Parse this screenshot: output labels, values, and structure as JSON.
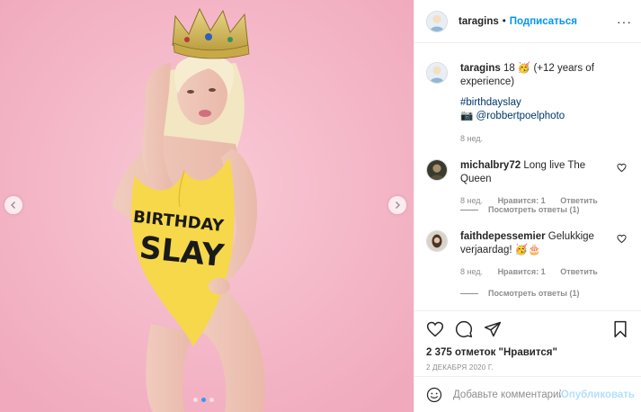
{
  "header": {
    "username": "taragins",
    "separator": "•",
    "follow_label": "Подписаться",
    "more_label": "···"
  },
  "caption": {
    "username": "taragins",
    "text_1": " 18 🥳 (+12 years of experience)",
    "hashtag": "#birthdayslay",
    "camera_emoji": "📷",
    "mention": "@robbertpoelphoto",
    "time": "8 нед."
  },
  "comments": [
    {
      "username": "michalbry72",
      "text": " Long live The Queen",
      "time": "8 нед.",
      "likes": "Нравится: 1",
      "reply_label": "Ответить",
      "view_replies": "Посмотреть ответы (1)"
    },
    {
      "username": "faithdepessemier",
      "text": " Gelukkige verjaardag! 🥳🎂",
      "time": "8 нед.",
      "likes": "Нравится: 1",
      "reply_label": "Ответить",
      "view_replies": "Посмотреть ответы (1)"
    }
  ],
  "actions": {
    "likes": "2 375 отметок \"Нравится\"",
    "date": "2 ДЕКАБРЯ 2020 Г."
  },
  "add_comment": {
    "placeholder": "Добавьте комментарий...",
    "post_label": "Опубликовать"
  },
  "photo": {
    "swimsuit_text_1": "BIRTHDAY",
    "swimsuit_text_2": "SLAY",
    "background_color": "#f4b9c9",
    "swimsuit_color": "#f6d84a"
  },
  "carousel": {
    "slide_count": 3,
    "active_index": 1
  },
  "colors": {
    "link_blue": "#0095f6",
    "text": "#262626",
    "muted": "#8e8e8e",
    "border": "#efefef"
  }
}
